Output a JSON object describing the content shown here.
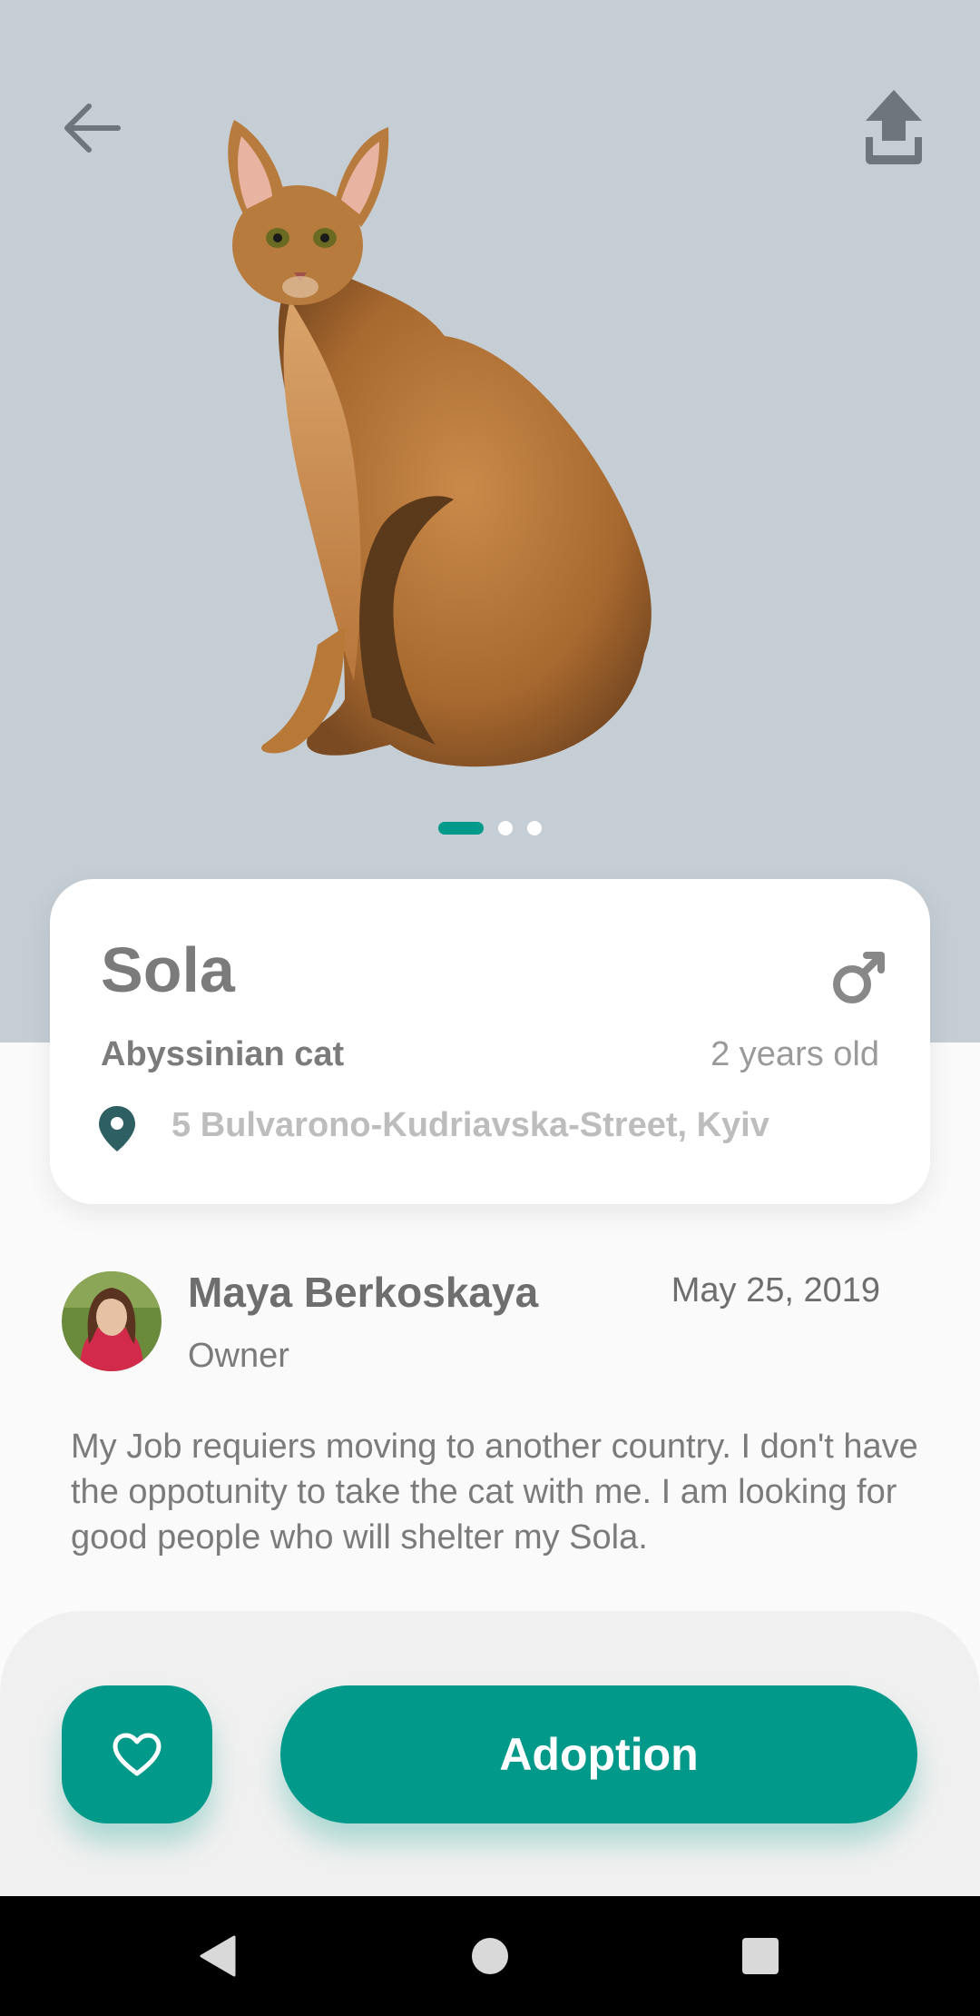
{
  "header": {
    "back_icon": "arrow-left-icon",
    "share_icon": "upload-share-icon"
  },
  "gallery": {
    "total_slides": 3,
    "active_slide": 1
  },
  "pet": {
    "name": "Sola",
    "breed": "Abyssinian cat",
    "age": "2 years old",
    "gender_icon": "male-gender-icon",
    "address": "5 Bulvarono-Kudriavska-Street, Kyiv"
  },
  "owner": {
    "name": "Maya Berkoskaya",
    "role": "Owner",
    "date": "May 25, 2019"
  },
  "description": "My Job requiers moving to another country. I don't have the oppotunity to take the cat with me. I am looking for good people who will shelter my Sola.",
  "actions": {
    "favorite_icon": "heart-outline-icon",
    "adopt_label": "Adoption"
  },
  "colors": {
    "accent": "#00998a",
    "hero_bg": "#c5ced4",
    "text_primary": "#7b7b7b"
  },
  "nav": {
    "back_icon": "nav-back-icon",
    "home_icon": "nav-home-icon",
    "recents_icon": "nav-recents-icon"
  }
}
